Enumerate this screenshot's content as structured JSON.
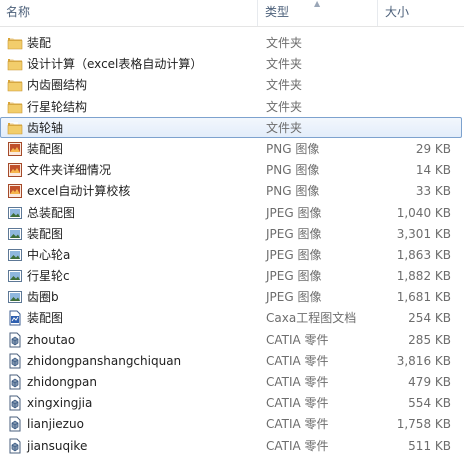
{
  "header": {
    "name": "名称",
    "type": "类型",
    "size": "大小"
  },
  "colors": {
    "folder": "#e8b84a",
    "png": "#c0502c",
    "jpeg": "#3a7cc0",
    "caxa": "#2e5fb0",
    "catia": "#2c4f7c"
  },
  "rows": [
    {
      "name": "装配",
      "type": "文件夹",
      "size": "",
      "icon": "folder-icon"
    },
    {
      "name": "设计计算（excel表格自动计算）",
      "type": "文件夹",
      "size": "",
      "icon": "folder-icon"
    },
    {
      "name": "内齿圈结构",
      "type": "文件夹",
      "size": "",
      "icon": "folder-icon"
    },
    {
      "name": "行星轮结构",
      "type": "文件夹",
      "size": "",
      "icon": "folder-icon"
    },
    {
      "name": "齿轮轴",
      "type": "文件夹",
      "size": "",
      "icon": "folder-icon",
      "selected": true
    },
    {
      "name": "装配图",
      "type": "PNG 图像",
      "size": "29 KB",
      "icon": "png-image-icon"
    },
    {
      "name": "文件夹详细情况",
      "type": "PNG 图像",
      "size": "14 KB",
      "icon": "png-image-icon"
    },
    {
      "name": "excel自动计算校核",
      "type": "PNG 图像",
      "size": "33 KB",
      "icon": "png-image-icon"
    },
    {
      "name": "总装配图",
      "type": "JPEG 图像",
      "size": "1,040 KB",
      "icon": "jpeg-image-icon"
    },
    {
      "name": "装配图",
      "type": "JPEG 图像",
      "size": "3,301 KB",
      "icon": "jpeg-image-icon"
    },
    {
      "name": "中心轮a",
      "type": "JPEG 图像",
      "size": "1,863 KB",
      "icon": "jpeg-image-icon"
    },
    {
      "name": "行星轮c",
      "type": "JPEG 图像",
      "size": "1,882 KB",
      "icon": "jpeg-image-icon"
    },
    {
      "name": "齿圈b",
      "type": "JPEG 图像",
      "size": "1,681 KB",
      "icon": "jpeg-image-icon"
    },
    {
      "name": "装配图",
      "type": "Caxa工程图文档",
      "size": "254 KB",
      "icon": "caxa-document-icon"
    },
    {
      "name": "zhoutao",
      "type": "CATIA 零件",
      "size": "285 KB",
      "icon": "catia-part-icon"
    },
    {
      "name": "zhidongpanshangchiquan",
      "type": "CATIA 零件",
      "size": "3,816 KB",
      "icon": "catia-part-icon"
    },
    {
      "name": "zhidongpan",
      "type": "CATIA 零件",
      "size": "479 KB",
      "icon": "catia-part-icon"
    },
    {
      "name": "xingxingjia",
      "type": "CATIA 零件",
      "size": "554 KB",
      "icon": "catia-part-icon"
    },
    {
      "name": "lianjiezuo",
      "type": "CATIA 零件",
      "size": "1,758 KB",
      "icon": "catia-part-icon"
    },
    {
      "name": "jiansuqike",
      "type": "CATIA 零件",
      "size": "511 KB",
      "icon": "catia-part-icon"
    }
  ]
}
